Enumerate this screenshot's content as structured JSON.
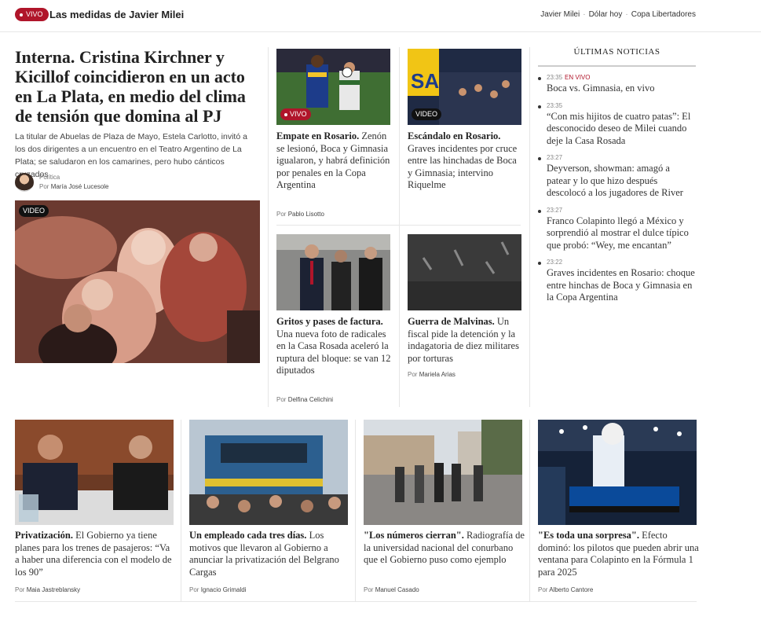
{
  "topbar": {
    "live_label": "VIVO",
    "title": "Las medidas de Javier Milei",
    "links": [
      "Javier Milei",
      "Dólar hoy",
      "Copa Libertadores"
    ]
  },
  "lead": {
    "kicker": "Interna.",
    "headline": "Cristina Kirchner y Kicillof coincidieron en un acto en La Plata, en medio del clima de tensión que domina al PJ",
    "description": "La titular de Abuelas de Plaza de Mayo, Estela Carlotto, invitó a los dos dirigentes a un encuentro en el Teatro Argentino de La Plata; se saludaron en los camarines, pero hubo cánticos cruzados",
    "section": "Política",
    "by_prefix": "Por",
    "author": "María José Lucesole",
    "badge": "VIDEO"
  },
  "cards": [
    {
      "kicker": "Empate en Rosario.",
      "text": "Zenón se lesionó, Boca y Gimnasia igualaron, y habrá definición por penales en la Copa Argentina",
      "by_prefix": "Por",
      "author": "Pablo Lisotto",
      "badge": "VIVO"
    },
    {
      "kicker": "Escándalo en Rosario.",
      "text": "Graves incidentes por cruce entre las hinchadas de Boca y Gimnasia; intervino Riquelme",
      "badge": "VIDEO"
    },
    {
      "kicker": "Gritos y pases de factura.",
      "text": "Una nueva foto de radicales en la Casa Rosada aceleró la ruptura del bloque: se van 12 diputados",
      "by_prefix": "Por",
      "author": "Delfina Celichini"
    },
    {
      "kicker": "Guerra de Malvinas.",
      "text": "Un fiscal pide la detención y la indagatoria de diez militares por torturas",
      "by_prefix": "Por",
      "author": "Mariela Arias"
    }
  ],
  "latest": {
    "heading": "ÚLTIMAS NOTICIAS",
    "live_label": "EN VIVO",
    "items": [
      {
        "time": "23:35",
        "text": "Boca vs. Gimnasia, en vivo"
      },
      {
        "time": "23:35",
        "text": "“Con mis hijitos de cuatro patas”: El desconocido deseo de Milei cuando deje la Casa Rosada"
      },
      {
        "time": "23:27",
        "text": "Deyverson, showman: amagó a patear y lo que hizo después descolocó a los jugadores de River"
      },
      {
        "time": "23:27",
        "text": "Franco Colapinto llegó a México y sorprendió al mostrar el dulce típico que probó: “Wey, me encantan”"
      },
      {
        "time": "23:22",
        "text": "Graves incidentes en Rosario: choque entre hinchas de Boca y Gimnasia en la Copa Argentina"
      }
    ]
  },
  "bottom": [
    {
      "kicker": "Privatización.",
      "text": "El Gobierno ya tiene planes para los trenes de pasajeros: “Va a haber una diferencia con el modelo de los 90”",
      "by_prefix": "Por",
      "author": "Maia Jastreblansky"
    },
    {
      "kicker": "Un empleado cada tres días.",
      "text": "Los motivos que llevaron al Gobierno a anunciar la privatización del Belgrano Cargas",
      "by_prefix": "Por",
      "author": "Ignacio Grimaldi"
    },
    {
      "kicker": "\"Los números cierran\".",
      "text": "Radiografía de la universidad nacional del conurbano que el Gobierno puso como ejemplo",
      "by_prefix": "Por",
      "author": "Manuel Casado"
    },
    {
      "kicker": "\"Es toda una sorpresa\".",
      "text": "Efecto dominó: los pilotos que pueden abrir una ventana para Colapinto en la Fórmula 1 para 2025",
      "by_prefix": "Por",
      "author": "Alberto Cantore"
    }
  ]
}
